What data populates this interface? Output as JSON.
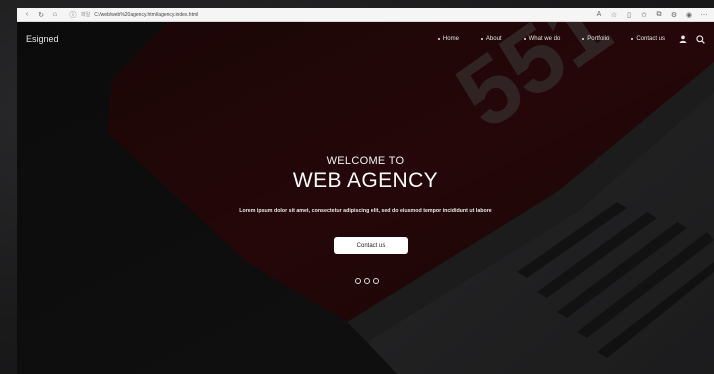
{
  "browser": {
    "address_tag": "파일",
    "address_url": "C:/web/web%20agency.html/agency.index.html"
  },
  "nav": {
    "brand": "Esigned",
    "items": [
      "Home",
      "About",
      "What we do",
      "Portfolio",
      "Contact us"
    ]
  },
  "hero": {
    "welcome": "WELCOME TO",
    "headline": "WEB AGENCY",
    "body": "Lorem ipsum dolor sit amet, consectetur adipiscing elit, sed do eiusmod tempor incididunt ut labore",
    "cta_label": "Contact us",
    "slide_dots": 3
  },
  "icons": {
    "user": "user-icon",
    "search": "search-icon"
  }
}
